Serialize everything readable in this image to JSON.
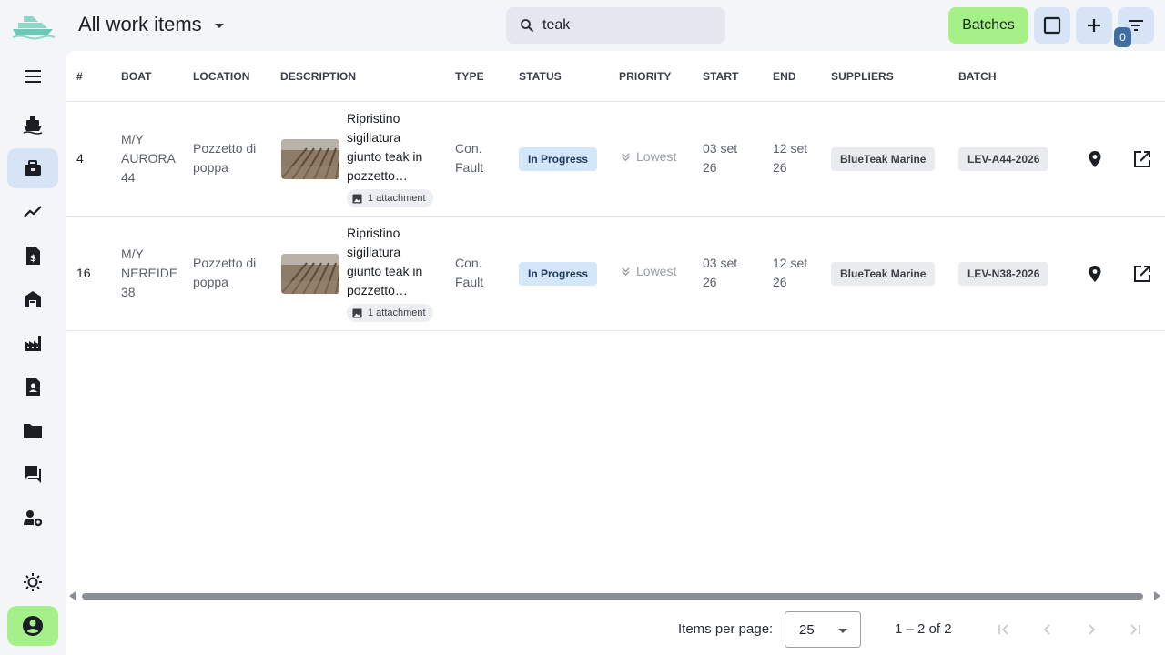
{
  "header": {
    "title": "All work items",
    "search_value": "teak",
    "batches_label": "Batches",
    "filter_count": "0"
  },
  "sidebar": {
    "items": [
      {
        "icon": "menu-icon"
      },
      {
        "icon": "boat-icon"
      },
      {
        "icon": "briefcase-icon",
        "active": true
      },
      {
        "icon": "trend-icon"
      },
      {
        "icon": "invoice-icon"
      },
      {
        "icon": "warehouse-icon"
      },
      {
        "icon": "factory-icon"
      },
      {
        "icon": "contact-icon"
      },
      {
        "icon": "folder-icon"
      },
      {
        "icon": "chat-icon"
      },
      {
        "icon": "user-settings-icon"
      },
      {
        "icon": "theme-icon"
      },
      {
        "icon": "account-icon"
      }
    ]
  },
  "table": {
    "headers": {
      "num": "#",
      "boat": "BOAT",
      "location": "LOCATION",
      "description": "DESCRIPTION",
      "type": "TYPE",
      "status": "STATUS",
      "priority": "PRIORITY",
      "start": "START",
      "end": "END",
      "suppliers": "SUPPLIERS",
      "batch": "BATCH"
    },
    "rows": [
      {
        "num": "4",
        "boat": "M/Y AURORA 44",
        "location": "Pozzetto di poppa",
        "description": "Ripristino sigillatura giunto teak in pozzetto…",
        "attachment": "1 attachment",
        "type": "Con. Fault",
        "status": "In Progress",
        "priority": "Lowest",
        "start": "03 set 26",
        "end": "12 set 26",
        "supplier": "BlueTeak Marine",
        "batch": "LEV-A44-2026"
      },
      {
        "num": "16",
        "boat": "M/Y NEREIDE 38",
        "location": "Pozzetto di poppa",
        "description": "Ripristino sigillatura giunto teak in pozzetto…",
        "attachment": "1 attachment",
        "type": "Con. Fault",
        "status": "In Progress",
        "priority": "Lowest",
        "start": "03 set 26",
        "end": "12 set 26",
        "supplier": "BlueTeak Marine",
        "batch": "LEV-N38-2026"
      }
    ]
  },
  "paginator": {
    "items_per_page_label": "Items per page:",
    "page_size": "25",
    "range": "1 – 2 of 2"
  },
  "colors": {
    "accent_green": "#a6f08a",
    "accent_blue": "#d6e4f6",
    "status_chip": "#d4e6fa"
  }
}
